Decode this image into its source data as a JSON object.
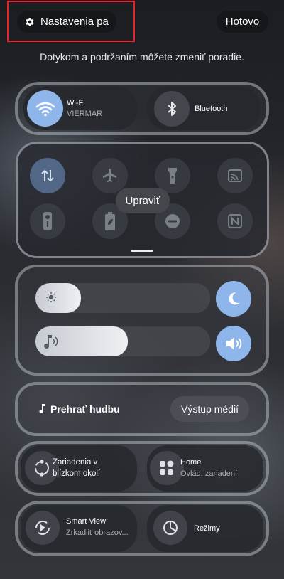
{
  "header": {
    "settings_label": "Nastavenia pa",
    "done_label": "Hotovo",
    "hint": "Dotykom a podržaním môžete zmeniť poradie."
  },
  "top_row": {
    "wifi": {
      "title": "Wi-Fi",
      "subtitle": "VIERMAR",
      "icon": "wifi-icon"
    },
    "bluetooth": {
      "title": "Bluetooth",
      "icon": "bluetooth-icon"
    }
  },
  "quick_tiles": {
    "icons": [
      "data-transfer-icon",
      "airplane-icon",
      "flashlight-icon",
      "cast-icon",
      "remote-icon",
      "battery-saver-icon",
      "do-not-disturb-icon",
      "nfc-icon"
    ],
    "edit_label": "Upraviť"
  },
  "sliders": {
    "brightness_level": 0.26,
    "volume_level": 0.53
  },
  "media": {
    "title": "Prehrať hudbu",
    "output_label": "Výstup médií"
  },
  "devices": {
    "nearby": {
      "line1": "Zariadenia v",
      "line2": "blízkom okolí"
    },
    "home": {
      "title": "Home",
      "subtitle": "Ovlád. zariadení"
    }
  },
  "bottom_row": {
    "smart_view": {
      "title": "Smart View",
      "subtitle": "Zrkadliť obrazov..."
    },
    "modes": {
      "title": "Režimy"
    }
  },
  "colors": {
    "accent": "#8eb6ea",
    "highlight_border": "#e3262b"
  }
}
